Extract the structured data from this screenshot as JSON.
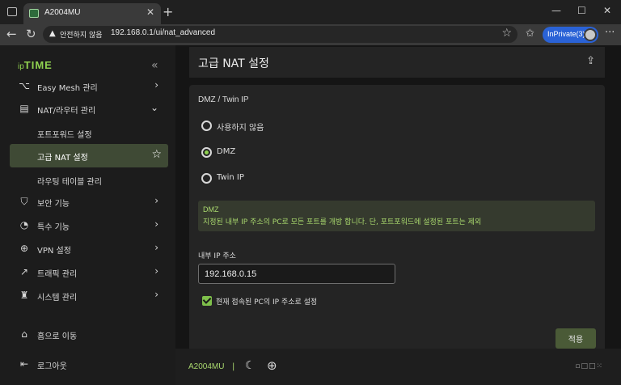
{
  "browser": {
    "tab_title": "A2004MU",
    "address_warning": "안전하지 않음",
    "url": "192.168.0.1/ui/nat_advanced",
    "inprivate_label": "InPrivate(3)"
  },
  "sidebar": {
    "logo_prefix": "ip",
    "logo_main": "TIME",
    "items": [
      {
        "label": "Easy Mesh 관리"
      },
      {
        "label": "NAT/라우터 관리"
      },
      {
        "label": "보안 기능"
      },
      {
        "label": "특수 기능"
      },
      {
        "label": "VPN 설정"
      },
      {
        "label": "트래픽 관리"
      },
      {
        "label": "시스템 관리"
      }
    ],
    "subitems": [
      {
        "label": "포트포워드 설정"
      },
      {
        "label": "고급 NAT 설정"
      },
      {
        "label": "라우팅 테이블 관리"
      }
    ],
    "home_label": "홈으로 이동",
    "logout_label": "로그아웃"
  },
  "main": {
    "page_title": "고급 NAT 설정",
    "section_title": "DMZ / Twin IP",
    "options": [
      "사용하지 않음",
      "DMZ",
      "Twin IP"
    ],
    "selected_option": "DMZ",
    "info_title": "DMZ",
    "info_desc": "지정된 내부 IP 주소의 PC로 모든 포트를 개방 합니다. 단, 포트포워드에 설정된 포트는 제외",
    "ip_label": "내부 IP 주소",
    "ip_value": "192.168.0.15",
    "checkbox_label": "현재 접속된 PC의 IP 주소로 설정",
    "checkbox_checked": true,
    "apply_label": "적용"
  },
  "footer": {
    "model": "A2004MU",
    "separator": "|"
  },
  "colors": {
    "accent": "#8fd14f",
    "active_bg": "#3f4a35",
    "inprivate": "#2a62d6"
  }
}
